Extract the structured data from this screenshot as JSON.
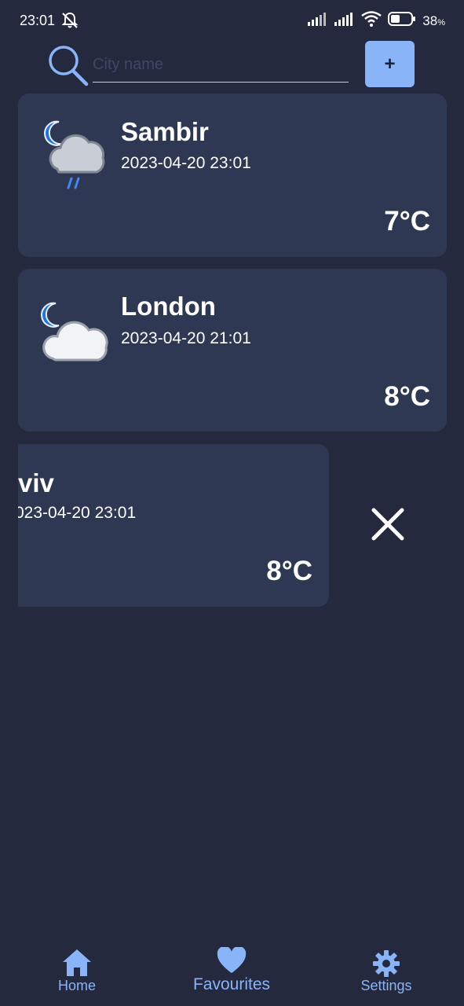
{
  "status_bar": {
    "time": "23:01",
    "battery_percent": "38",
    "battery_unit": "%"
  },
  "search": {
    "placeholder": "City name",
    "value": "",
    "add_label": "+"
  },
  "cards": [
    {
      "city": "Sambir",
      "datetime": "2023-04-20 23:01",
      "temp": "7°C",
      "icon": "night-cloud-rain-icon"
    },
    {
      "city": "London",
      "datetime": "2023-04-20 21:01",
      "temp": "8°C",
      "icon": "night-cloud-icon"
    },
    {
      "city": "viv",
      "datetime": "023-04-20 23:01",
      "temp": "8°C",
      "icon": "none"
    }
  ],
  "nav": {
    "home": "Home",
    "favourites": "Favourites",
    "settings": "Settings",
    "active": "favourites"
  },
  "colors": {
    "background": "#24293d",
    "card": "#2f3853",
    "accent": "#8ab4f8"
  }
}
